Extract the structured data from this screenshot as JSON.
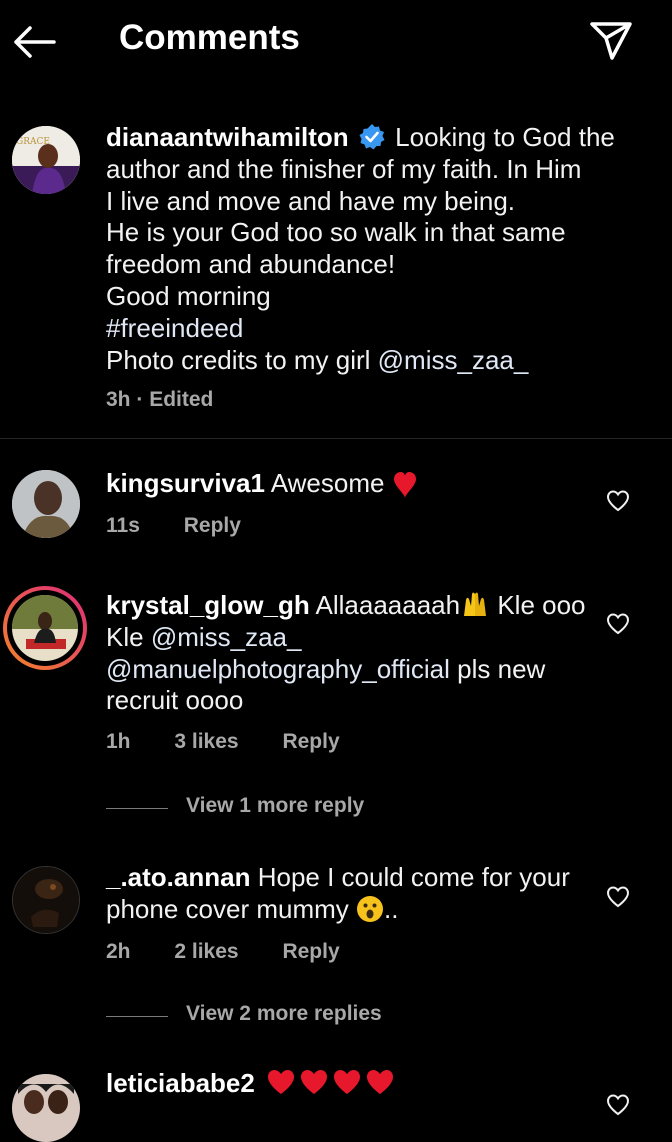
{
  "header": {
    "title": "Comments"
  },
  "caption": {
    "username": "dianaantwihamilton",
    "lines": [
      "Looking to God the",
      "author and the finisher of my faith. In Him",
      "I live and move and have my being.",
      "He is your God too so walk in that same",
      "freedom and abundance!",
      "Good morning",
      "#freeindeed",
      "Photo credits to my girl "
    ],
    "mention": "@miss_zaa_",
    "time": "3h",
    "edited": "Edited",
    "avatar_text": "GRACE"
  },
  "comments": [
    {
      "username": "kingsurviva1",
      "text": "Awesome",
      "time": "11s",
      "reply": "Reply"
    },
    {
      "username": "krystal_glow_gh",
      "text_a": "Allaaaaaaah",
      "text_b": " Kle ooo",
      "line2": "Kle ",
      "mention1": "@miss_zaa_",
      "mention2": "@manuelphotography_official",
      "line3_rest": " pls new",
      "line4": "recruit oooo",
      "time": "1h",
      "likes": "3 likes",
      "reply": "Reply",
      "view_more": "View 1 more reply"
    },
    {
      "username": "_.ato.annan",
      "text": "Hope I could come for your",
      "line2": "phone cover mummy ",
      "line2_end": "..",
      "time": "2h",
      "likes": "2 likes",
      "reply": "Reply",
      "view_more": "View 2 more replies"
    },
    {
      "username": "leticiababe2"
    }
  ],
  "colors": {
    "verified": "#3897f0",
    "heart_emoji": "#e8182c",
    "story_ring": [
      "#f58529",
      "#dd2a7b"
    ]
  }
}
